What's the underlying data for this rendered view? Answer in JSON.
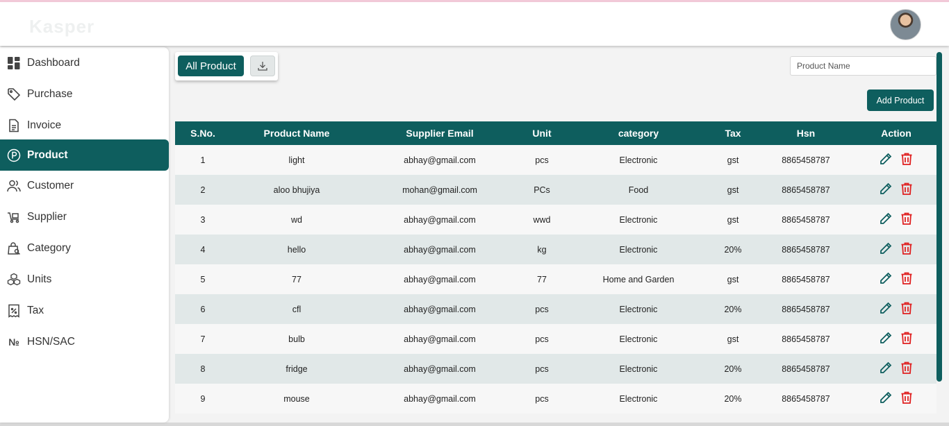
{
  "app": {
    "logo": "Kasper"
  },
  "sidebar": {
    "items": [
      {
        "label": "Dashboard",
        "icon": "dashboard-icon"
      },
      {
        "label": "Purchase",
        "icon": "tag-icon"
      },
      {
        "label": "Invoice",
        "icon": "invoice-icon"
      },
      {
        "label": "Product",
        "icon": "product-p-icon",
        "active": true
      },
      {
        "label": "Customer",
        "icon": "users-icon"
      },
      {
        "label": "Supplier",
        "icon": "supplier-icon"
      },
      {
        "label": "Category",
        "icon": "category-bag-icon"
      },
      {
        "label": "Units",
        "icon": "units-cubes-icon"
      },
      {
        "label": "Tax",
        "icon": "tax-receipt-icon"
      },
      {
        "label": "HSN/SAC",
        "icon": "numero-icon"
      }
    ]
  },
  "toolbar": {
    "all_product_label": "All Product",
    "download_icon": "download-icon",
    "search_placeholder": "Product Name",
    "add_product_label": "Add Product"
  },
  "table": {
    "headers": [
      "S.No.",
      "Product Name",
      "Supplier Email",
      "Unit",
      "category",
      "Tax",
      "Hsn",
      "Action"
    ],
    "rows": [
      [
        "1",
        "light",
        "abhay@gmail.com",
        "pcs",
        "Electronic",
        "gst",
        "8865458787"
      ],
      [
        "2",
        "aloo bhujiya",
        "mohan@gmail.com",
        "PCs",
        "Food",
        "gst",
        "8865458787"
      ],
      [
        "3",
        "wd",
        "abhay@gmail.com",
        "wwd",
        "Electronic",
        "gst",
        "8865458787"
      ],
      [
        "4",
        "hello",
        "abhay@gmail.com",
        "kg",
        "Electronic",
        "20%",
        "8865458787"
      ],
      [
        "5",
        "77",
        "abhay@gmail.com",
        "77",
        "Home and Garden",
        "gst",
        "8865458787"
      ],
      [
        "6",
        "cfl",
        "abhay@gmail.com",
        "pcs",
        "Electronic",
        "20%",
        "8865458787"
      ],
      [
        "7",
        "bulb",
        "abhay@gmail.com",
        "pcs",
        "Electronic",
        "gst",
        "8865458787"
      ],
      [
        "8",
        "fridge",
        "abhay@gmail.com",
        "pcs",
        "Electronic",
        "20%",
        "8865458787"
      ],
      [
        "9",
        "mouse",
        "abhay@gmail.com",
        "pcs",
        "Electronic",
        "20%",
        "8865458787"
      ]
    ]
  },
  "colors": {
    "primary": "#0e5e5e",
    "delete": "#e02020",
    "edit": "#0e5e5e"
  }
}
